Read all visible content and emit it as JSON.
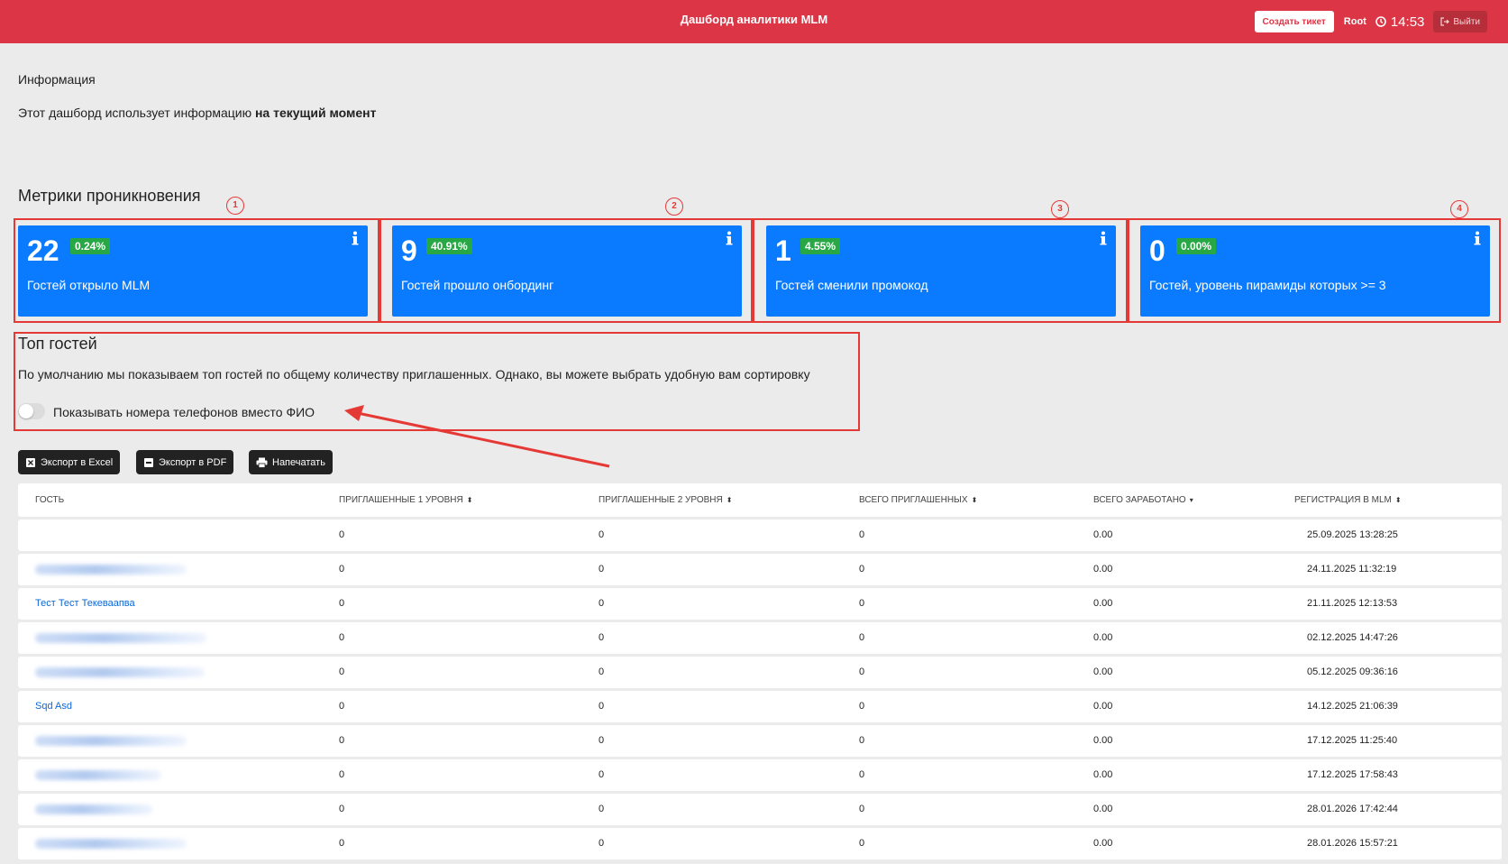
{
  "header": {
    "title": "Дашборд аналитики MLM",
    "ticket_button": "Создать тикет",
    "user": "Root",
    "time": "14:53",
    "logout_button": "Выйти"
  },
  "info": {
    "heading": "Информация",
    "text_prefix": "Этот дашборд использует информацию ",
    "text_bold": "на текущий момент"
  },
  "metrics": {
    "title": "Метрики проникновения",
    "cards": [
      {
        "marker": "1",
        "value": "22",
        "percent": "0.24%",
        "label": "Гостей открыло MLM"
      },
      {
        "marker": "2",
        "value": "9",
        "percent": "40.91%",
        "label": "Гостей прошло онбординг"
      },
      {
        "marker": "3",
        "value": "1",
        "percent": "4.55%",
        "label": "Гостей сменили промокод"
      },
      {
        "marker": "4",
        "value": "0",
        "percent": "0.00%",
        "label": "Гостей, уровень пирамиды которых >= 3"
      }
    ]
  },
  "top_guests": {
    "title": "Топ гостей",
    "description": "По умолчанию мы показываем топ гостей по общему количеству приглашенных. Однако, вы можете выбрать удобную вам сортировку",
    "toggle_label": "Показывать номера телефонов вместо ФИО",
    "toggle_on": false
  },
  "export": {
    "excel": "Экспорт в Excel",
    "pdf": "Экспорт в PDF",
    "print": "Напечатать"
  },
  "table": {
    "columns": [
      {
        "label": "Гость",
        "sort": ""
      },
      {
        "label": "Приглашенные 1 уровня",
        "sort": "⬍"
      },
      {
        "label": "Приглашенные 2 уровня",
        "sort": "⬍"
      },
      {
        "label": "Всего приглашенных",
        "sort": "⬍"
      },
      {
        "label": "Всего заработано",
        "sort": "▾"
      },
      {
        "label": "Регистрация в MLM",
        "sort": "⬍"
      }
    ],
    "rows": [
      {
        "guest": "",
        "blurred": false,
        "l1": "0",
        "l2": "0",
        "total": "0",
        "earned": "0.00",
        "registered": "25.09.2025 13:28:25"
      },
      {
        "guest": "",
        "blurred": true,
        "l1": "0",
        "l2": "0",
        "total": "0",
        "earned": "0.00",
        "registered": "24.11.2025 11:32:19"
      },
      {
        "guest": "Тест Тест Текеваапва",
        "blurred": false,
        "l1": "0",
        "l2": "0",
        "total": "0",
        "earned": "0.00",
        "registered": "21.11.2025 12:13:53"
      },
      {
        "guest": "",
        "blurred": true,
        "l1": "0",
        "l2": "0",
        "total": "0",
        "earned": "0.00",
        "registered": "02.12.2025 14:47:26"
      },
      {
        "guest": "",
        "blurred": true,
        "l1": "0",
        "l2": "0",
        "total": "0",
        "earned": "0.00",
        "registered": "05.12.2025 09:36:16"
      },
      {
        "guest": "Sqd Asd",
        "blurred": false,
        "l1": "0",
        "l2": "0",
        "total": "0",
        "earned": "0.00",
        "registered": "14.12.2025 21:06:39"
      },
      {
        "guest": "",
        "blurred": true,
        "l1": "0",
        "l2": "0",
        "total": "0",
        "earned": "0.00",
        "registered": "17.12.2025 11:25:40"
      },
      {
        "guest": "",
        "blurred": true,
        "l1": "0",
        "l2": "0",
        "total": "0",
        "earned": "0.00",
        "registered": "17.12.2025 17:58:43"
      },
      {
        "guest": "",
        "blurred": true,
        "l1": "0",
        "l2": "0",
        "total": "0",
        "earned": "0.00",
        "registered": "28.01.2026 17:42:44"
      },
      {
        "guest": "",
        "blurred": true,
        "l1": "0",
        "l2": "0",
        "total": "0",
        "earned": "0.00",
        "registered": "28.01.2026 15:57:21"
      }
    ]
  },
  "colors": {
    "header_bg": "#dc3545",
    "card_bg": "#0a7bff",
    "percent_badge": "#28a745",
    "annotation": "#e53935",
    "link": "#0a66d6"
  }
}
